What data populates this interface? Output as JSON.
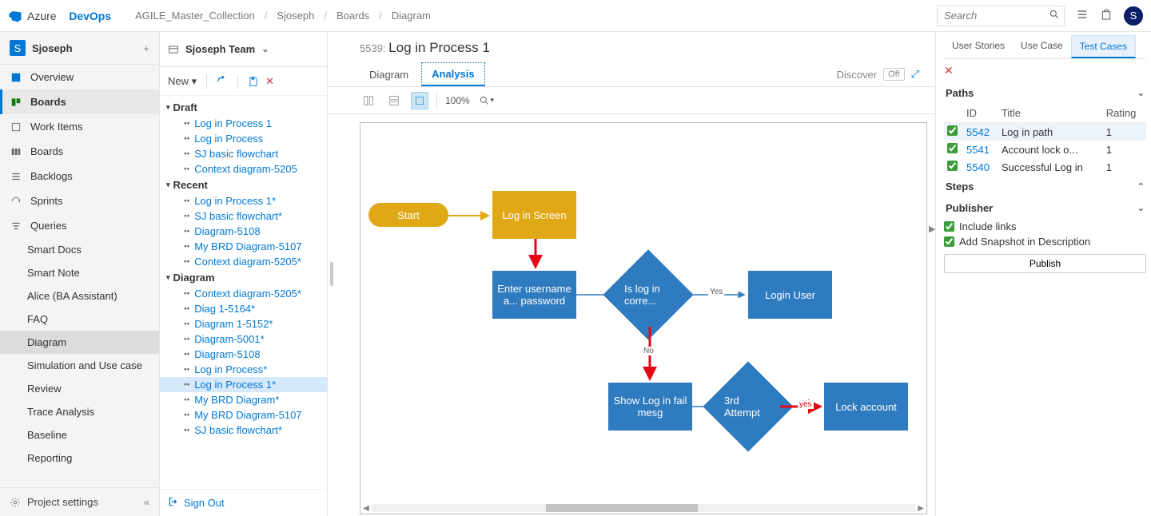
{
  "brand": {
    "w1": "Azure",
    "w2": "DevOps"
  },
  "breadcrumbs": [
    "AGILE_Master_Collection",
    "Sjoseph",
    "Boards",
    "Diagram"
  ],
  "search": {
    "placeholder": "Search"
  },
  "avatar": "S",
  "project": {
    "initial": "S",
    "name": "Sjoseph"
  },
  "leftnav": {
    "overview": "Overview",
    "boards": "Boards",
    "workitems": "Work Items",
    "boards2": "Boards",
    "backlogs": "Backlogs",
    "sprints": "Sprints",
    "queries": "Queries",
    "smartdocs": "Smart Docs",
    "smartnote": "Smart Note",
    "alice": "Alice (BA Assistant)",
    "faq": "FAQ",
    "diagram": "Diagram",
    "sim": "Simulation and Use case",
    "review": "Review",
    "trace": "Trace Analysis",
    "baseline": "Baseline",
    "reporting": "Reporting",
    "settings": "Project settings"
  },
  "team_header": "Sjoseph Team",
  "tree_toolbar": {
    "new": "New"
  },
  "tree": {
    "draft_label": "Draft",
    "draft": [
      "Log in Process 1",
      "Log in Process",
      "SJ basic flowchart",
      "Context diagram-5205"
    ],
    "recent_label": "Recent",
    "recent": [
      "Log in Process 1*",
      "SJ basic flowchart*",
      "Diagram-5108",
      "My BRD Diagram-5107",
      "Context diagram-5205*"
    ],
    "diagram_label": "Diagram",
    "diagram": [
      "Context diagram-5205*",
      "Diag 1-5164*",
      "Diagram 1-5152*",
      "Diagram-5001*",
      "Diagram-5108",
      "Log in Process*",
      "Log in Process 1*",
      "My BRD Diagram*",
      "My BRD Diagram-5107",
      "SJ basic flowchart*"
    ],
    "selected_diagram_index": 6
  },
  "signout": "Sign Out",
  "workitem": {
    "id": "5539:",
    "title": "Log in Process 1"
  },
  "tabs": {
    "diagram": "Diagram",
    "analysis": "Analysis"
  },
  "tabs_right": {
    "discover": "Discover",
    "off": "Off"
  },
  "canvas_toolbar": {
    "zoom": "100%"
  },
  "flow": {
    "start": "Start",
    "login_screen": "Log in Screen",
    "enter": "Enter username a... password",
    "is_correct": "Is log in corre...",
    "login_user": "Login User",
    "show_fail": "Show Log in fail mesg",
    "third_attempt": "3rd Attempt",
    "lock": "Lock account",
    "yes": "Yes",
    "no": "No",
    "yes2": "yes"
  },
  "rightpane": {
    "tabs": {
      "us": "User Stories",
      "uc": "Use Case",
      "tc": "Test Cases"
    },
    "paths_label": "Paths",
    "cols": {
      "id": "ID",
      "title": "Title",
      "rating": "Rating"
    },
    "rows": [
      {
        "id": "5542",
        "title": "Log in path",
        "rating": "1"
      },
      {
        "id": "5541",
        "title": "Account lock o...",
        "rating": "1"
      },
      {
        "id": "5540",
        "title": "Successful Log in",
        "rating": "1"
      }
    ],
    "steps_label": "Steps",
    "publisher_label": "Publisher",
    "include_links": "Include links",
    "snapshot": "Add Snapshot in Description",
    "publish": "Publish"
  }
}
